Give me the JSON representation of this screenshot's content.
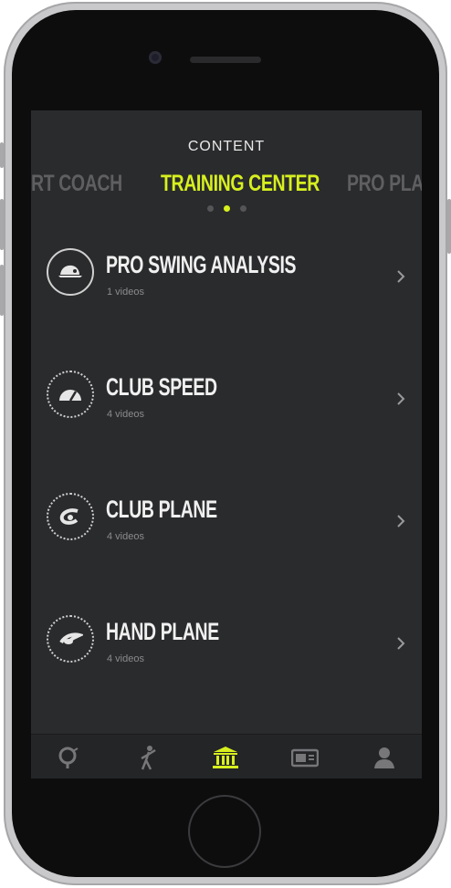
{
  "header": {
    "title": "CONTENT"
  },
  "carousel": {
    "tabs": [
      {
        "label": "RT COACH"
      },
      {
        "label": "TRAINING CENTER"
      },
      {
        "label": "PRO PLAY"
      }
    ],
    "active_index": 1
  },
  "list": {
    "items": [
      {
        "title": "PRO SWING ANALYSIS",
        "subtitle": "1 videos",
        "icon": "golfer-cap-icon"
      },
      {
        "title": "CLUB SPEED",
        "subtitle": "4 videos",
        "icon": "speedometer-icon"
      },
      {
        "title": "CLUB PLANE",
        "subtitle": "4 videos",
        "icon": "club-plane-icon"
      },
      {
        "title": "HAND PLANE",
        "subtitle": "4 videos",
        "icon": "hand-plane-icon"
      }
    ]
  },
  "tabbar": {
    "items": [
      {
        "icon": "coach-icon"
      },
      {
        "icon": "golfer-icon"
      },
      {
        "icon": "museum-icon",
        "active": true
      },
      {
        "icon": "video-icon"
      },
      {
        "icon": "profile-icon"
      }
    ]
  },
  "colors": {
    "accent": "#d7f01e",
    "screen_bg": "#2a2b2d",
    "inactive": "#5f5f61"
  }
}
